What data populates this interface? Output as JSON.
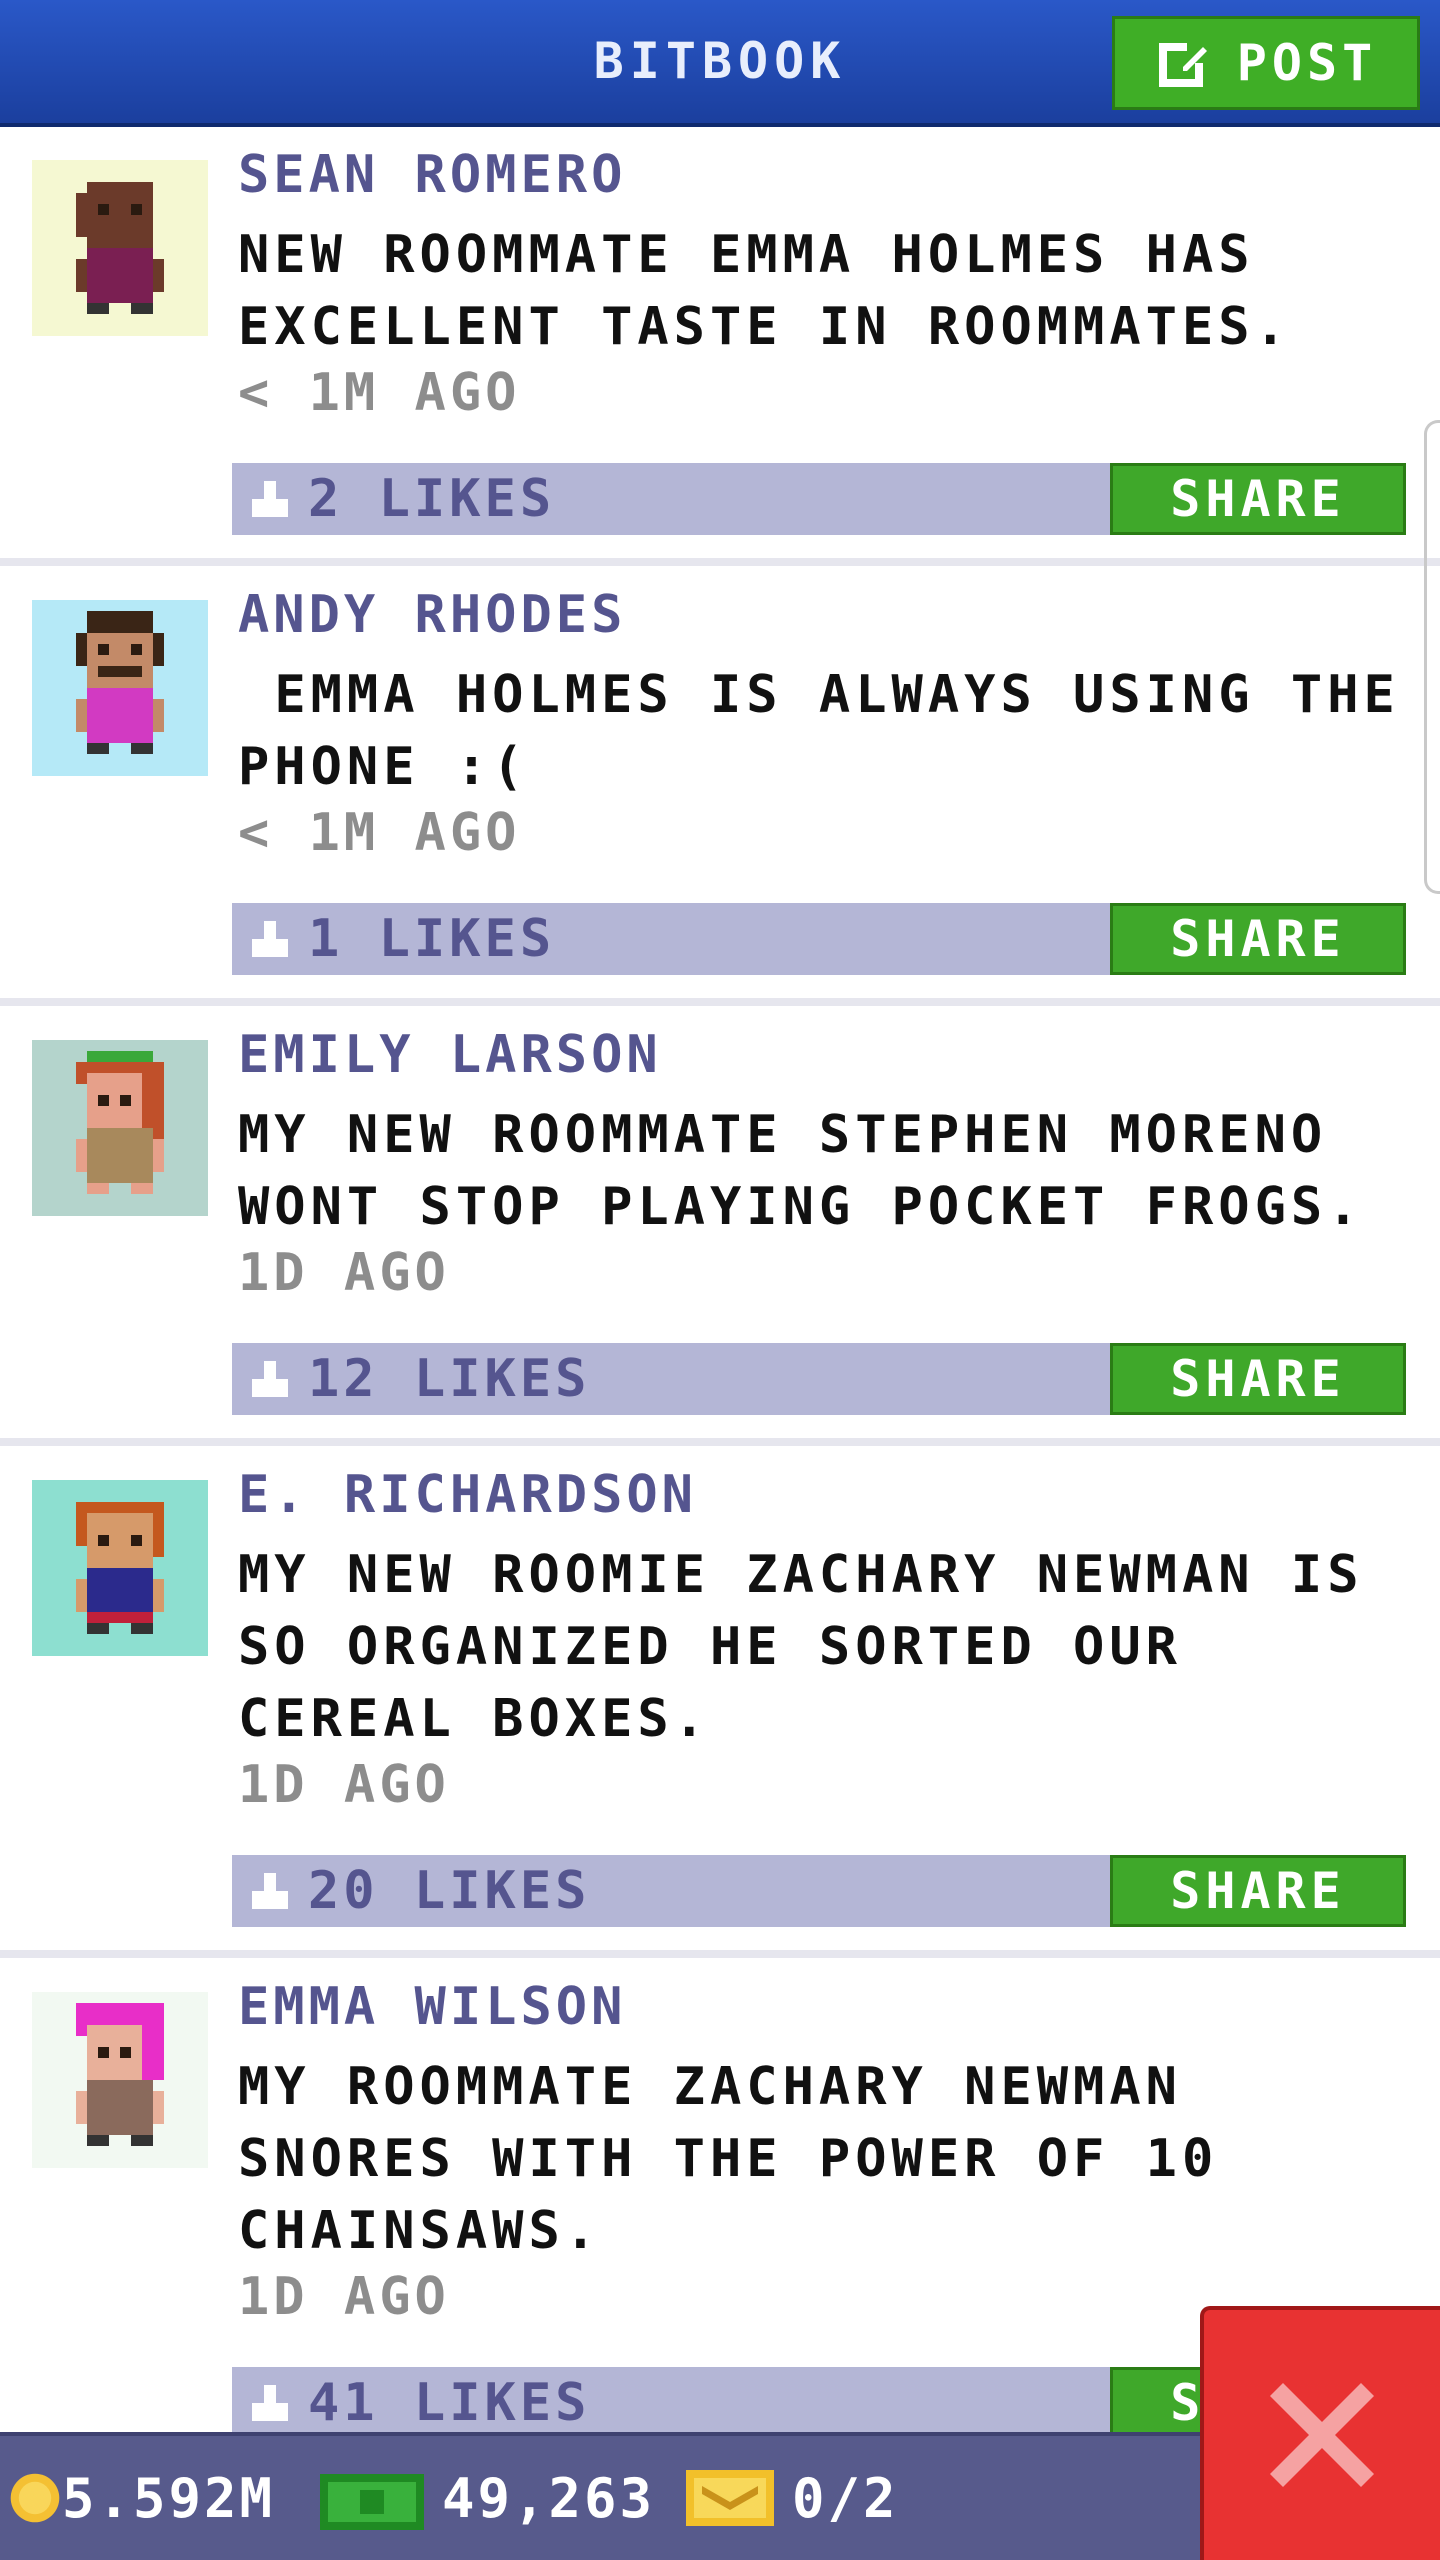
{
  "header": {
    "title": "BITBOOK",
    "post_label": "POST"
  },
  "posts": [
    {
      "author": "SEAN ROMERO",
      "text": "NEW ROOMMATE EMMA HOLMES HAS EXCELLENT TASTE IN ROOMMATES.",
      "time": "< 1M AGO",
      "likes": "2 LIKES",
      "share_label": "SHARE",
      "avatar_bg": "#f5f8d2"
    },
    {
      "author": "ANDY RHODES",
      "text": " EMMA HOLMES IS ALWAYS USING THE PHONE :(",
      "time": "< 1M AGO",
      "likes": "1 LIKES",
      "share_label": "SHARE",
      "avatar_bg": "#b5e9f7"
    },
    {
      "author": "EMILY LARSON",
      "text": "MY NEW ROOMMATE STEPHEN MORENO WONT STOP PLAYING POCKET FROGS.",
      "time": "1D AGO",
      "likes": "12 LIKES",
      "share_label": "SHARE",
      "avatar_bg": "#b4d4cc"
    },
    {
      "author": "E. RICHARDSON",
      "text": "MY NEW ROOMIE ZACHARY NEWMAN IS SO ORGANIZED HE SORTED OUR CEREAL BOXES.",
      "time": "1D AGO",
      "likes": "20 LIKES",
      "share_label": "SHARE",
      "avatar_bg": "#8ddfd0"
    },
    {
      "author": "EMMA WILSON",
      "text": "MY ROOMMATE ZACHARY NEWMAN SNORES WITH THE POWER OF 10 CHAINSAWS.",
      "time": "1D AGO",
      "likes": "41 LIKES",
      "share_label": "SHARE",
      "avatar_bg": "#f2f9f2"
    }
  ],
  "footer": {
    "coins": "5.592M",
    "bux": "49,263",
    "tickets": "0/2"
  },
  "colors": {
    "header": "#1f48b0",
    "post_green": "#3fae26",
    "likes_bar": "#b4b6d6",
    "author": "#55558f",
    "close_red": "#e83232",
    "footer": "#575a8c"
  },
  "icons": {
    "post": "edit-icon",
    "like": "thumbs-up-icon",
    "coin": "coin-icon",
    "bux": "bux-icon",
    "ticket": "ticket-icon",
    "close": "close-icon"
  }
}
